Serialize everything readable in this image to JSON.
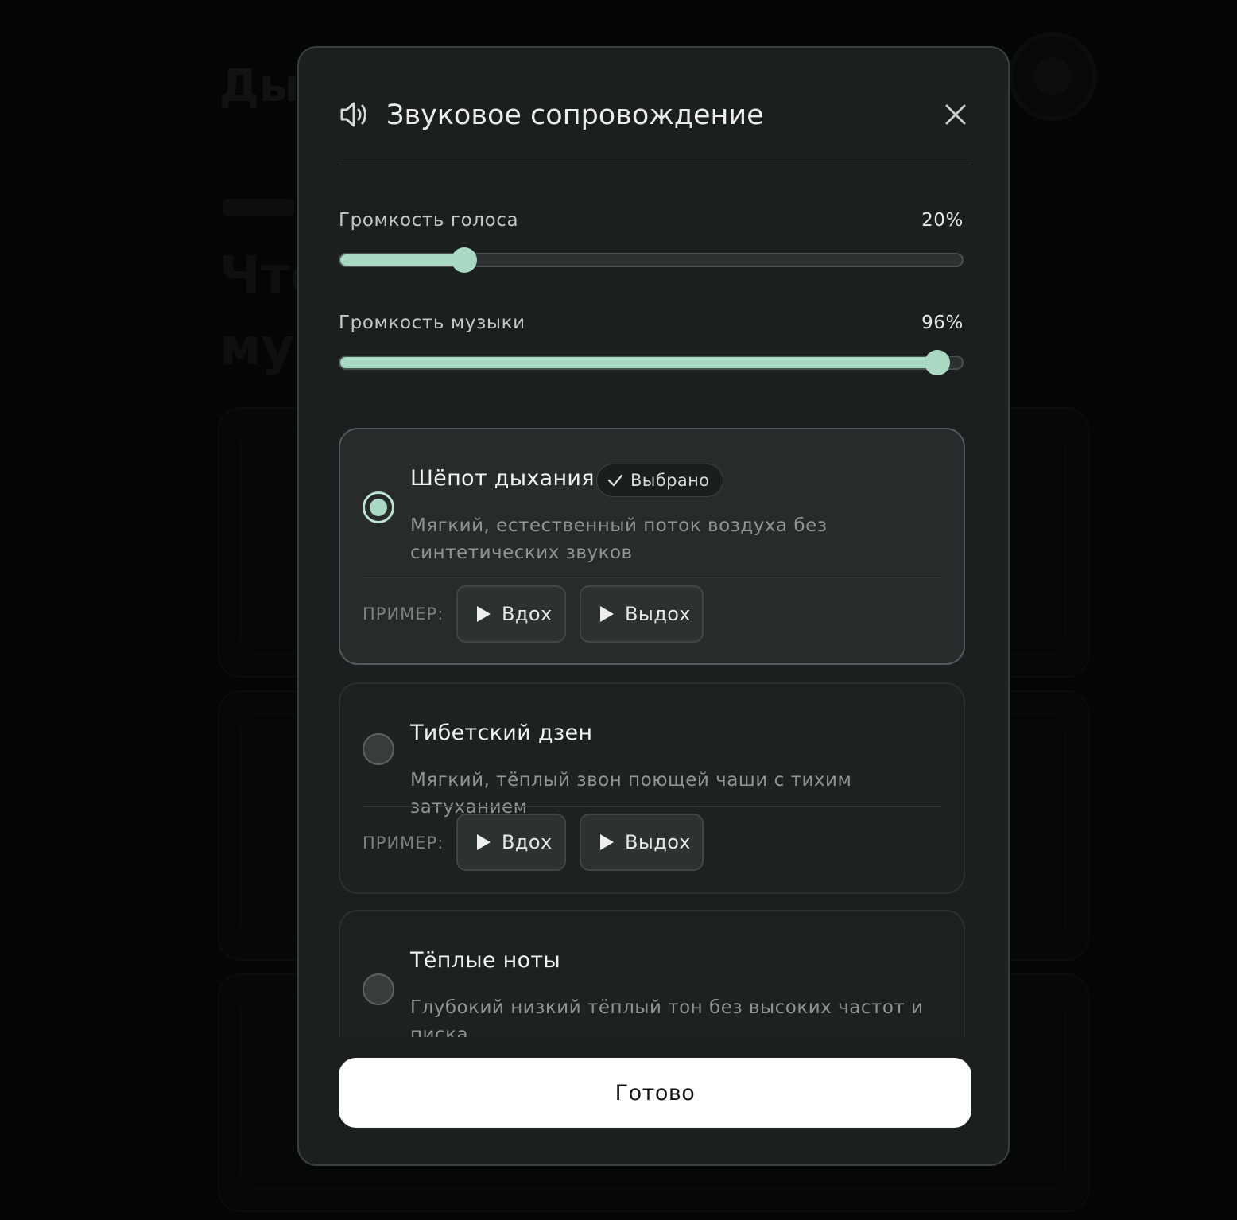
{
  "background": {
    "title_fragment": "Дых",
    "line1_fragment": "Что",
    "line2_fragment": "муз"
  },
  "modal": {
    "title": "Звуковое сопровождение",
    "icon": "speaker-icon",
    "close_icon": "close-icon"
  },
  "sliders": [
    {
      "label": "Громкость голоса",
      "value_text": "20%",
      "value": 0.2
    },
    {
      "label": "Громкость музыки",
      "value_text": "96%",
      "value": 0.96
    }
  ],
  "options": [
    {
      "title": "Шёпот дыхания",
      "selected": true,
      "badge": "Выбрано",
      "description": "Мягкий, естественный поток воздуха без синтетических звуков",
      "example_label": "ПРИМЕР:",
      "inhale": "Вдох",
      "exhale": "Выдох"
    },
    {
      "title": "Тибетский дзен",
      "selected": false,
      "description": "Мягкий, тёплый звон поющей чаши с тихим затуханием",
      "example_label": "ПРИМЕР:",
      "inhale": "Вдох",
      "exhale": "Выдох"
    },
    {
      "title": "Тёплые ноты",
      "selected": false,
      "description": "Глубокий низкий тёплый тон без высоких частот и писка"
    }
  ],
  "done_label": "Готово",
  "colors": {
    "accent": "#a9d9c2",
    "modal_bg": "#1c1f1f",
    "done_bg": "#ffffff"
  }
}
